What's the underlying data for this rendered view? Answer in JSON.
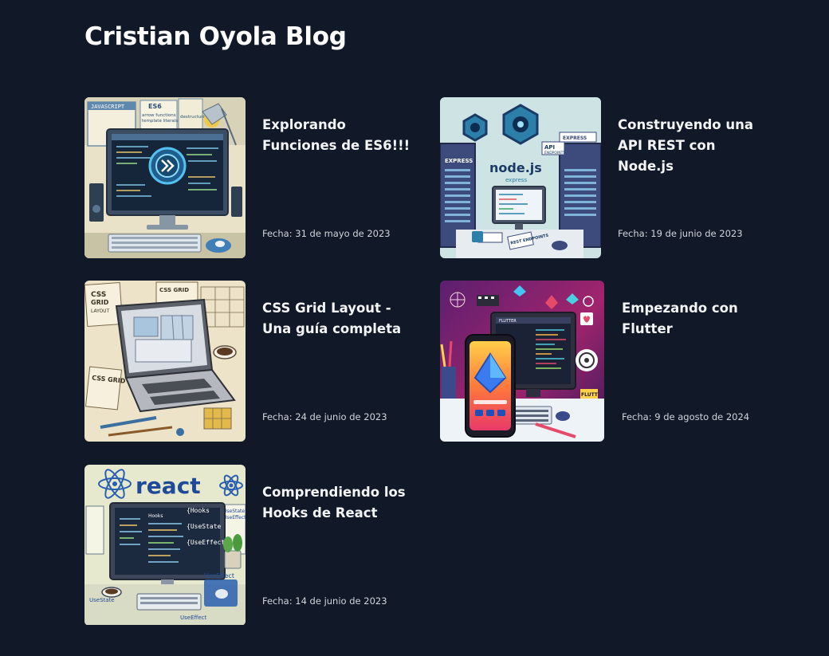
{
  "site": {
    "title": "Cristian Oyola Blog"
  },
  "posts": [
    {
      "title": "Explorando\nFunciones de ES6!!!",
      "date": "Fecha: 31 de mayo de 2023",
      "image": "es6-workspace-illustration",
      "image_text": [
        "JAVASCRIPT",
        "ES6",
        "arrow functions",
        "template literals",
        "destructuring"
      ]
    },
    {
      "title": "Construyendo una\nAPI REST con\nNode.js",
      "date": "Fecha: 19 de junio de 2023",
      "image": "nodejs-api-server-illustration",
      "image_text": [
        "node.js",
        "express",
        "EXPRESS",
        "API",
        "ENDPOINTS",
        "REST ENDPOINTS"
      ]
    },
    {
      "title": "CSS Grid Layout -\nUna guía completa",
      "date": "Fecha: 24 de junio de 2023",
      "image": "css-grid-laptop-illustration",
      "image_text": [
        "CSS GRID",
        "LAYOUT",
        "CSS GRID"
      ]
    },
    {
      "title": "Empezando con\nFlutter",
      "date": "Fecha: 9 de agosto de 2024",
      "image": "flutter-phone-illustration",
      "image_text": [
        "FLUTTER",
        "FLUTT"
      ]
    },
    {
      "title": "Comprendiendo los\nHooks de React",
      "date": "Fecha: 14 de junio de 2023",
      "image": "react-hooks-illustration",
      "image_text": [
        "react",
        "Hooks",
        "{Hooks",
        "{UseState",
        "{UseEffect",
        "UseState",
        "UseEffect"
      ]
    }
  ]
}
